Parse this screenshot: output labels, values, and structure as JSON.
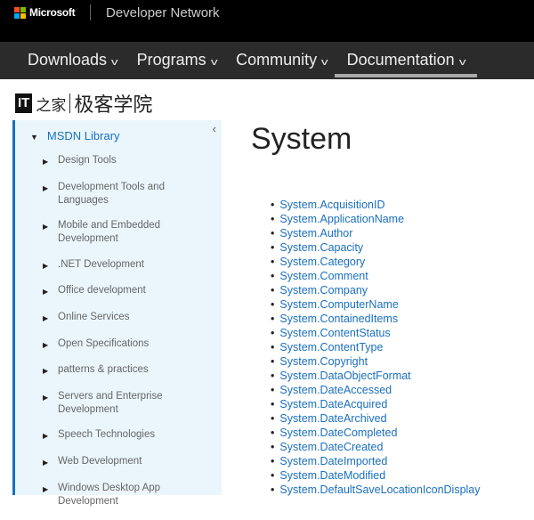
{
  "header": {
    "brand": "Microsoft",
    "site": "Developer Network",
    "logo_colors": [
      "#f25022",
      "#7fba00",
      "#00a4ef",
      "#ffb900"
    ]
  },
  "nav": [
    {
      "label": "Downloads"
    },
    {
      "label": "Programs"
    },
    {
      "label": "Community"
    },
    {
      "label": "Documentation",
      "active": true
    }
  ],
  "watermark": {
    "it": "IT",
    "cn1": "之家",
    "cn2": "极客学院"
  },
  "sidebar": {
    "root": "MSDN Library",
    "items": [
      "Design Tools",
      "Development Tools and Languages",
      "Mobile and Embedded Development",
      ".NET Development",
      "Office development",
      "Online Services",
      "Open Specifications",
      "patterns & practices",
      "Servers and Enterprise Development",
      "Speech Technologies",
      "Web Development",
      "Windows Desktop App Development"
    ]
  },
  "main": {
    "title": "System",
    "links": [
      "System.AcquisitionID",
      "System.ApplicationName",
      "System.Author",
      "System.Capacity",
      "System.Category",
      "System.Comment",
      "System.Company",
      "System.ComputerName",
      "System.ContainedItems",
      "System.ContentStatus",
      "System.ContentType",
      "System.Copyright",
      "System.DataObjectFormat",
      "System.DateAccessed",
      "System.DateAcquired",
      "System.DateArchived",
      "System.DateCompleted",
      "System.DateCreated",
      "System.DateImported",
      "System.DateModified",
      "System.DefaultSaveLocationIconDisplay"
    ]
  }
}
